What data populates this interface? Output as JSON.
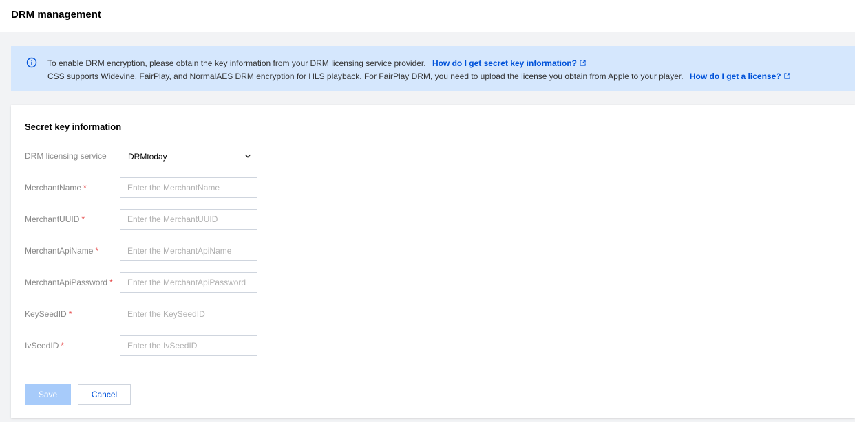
{
  "header": {
    "title": "DRM management"
  },
  "notice": {
    "line1_text": "To enable DRM encryption, please obtain the key information from your DRM licensing service provider.",
    "line1_link": "How do I get secret key information?",
    "line2_text": "CSS supports Widevine, FairPlay, and NormalAES DRM encryption for HLS playback. For FairPlay DRM, you need to upload the license you obtain from Apple to your player.",
    "line2_link": "How do I get a license?",
    "accent_color": "#0052d9",
    "background_color": "#d5e7fd"
  },
  "form": {
    "section_title": "Secret key information",
    "service": {
      "label": "DRM licensing service",
      "value": "DRMtoday"
    },
    "fields": [
      {
        "label": "MerchantName",
        "required_mark": "*",
        "placeholder": "Enter the MerchantName",
        "value": ""
      },
      {
        "label": "MerchantUUID",
        "required_mark": "*",
        "placeholder": "Enter the MerchantUUID",
        "value": ""
      },
      {
        "label": "MerchantApiName",
        "required_mark": "*",
        "placeholder": "Enter the MerchantApiName",
        "value": ""
      },
      {
        "label": "MerchantApiPassword",
        "required_mark": "*",
        "placeholder": "Enter the MerchantApiPassword",
        "value": ""
      },
      {
        "label": "KeySeedID",
        "required_mark": "*",
        "placeholder": "Enter the KeySeedID",
        "value": ""
      },
      {
        "label": "IvSeedID",
        "required_mark": "*",
        "placeholder": "Enter the IvSeedID",
        "value": ""
      }
    ]
  },
  "actions": {
    "save_label": "Save",
    "cancel_label": "Cancel",
    "save_disabled_color": "#a7cbfa"
  },
  "icons": {
    "info": "info-circle-icon",
    "external_link": "external-link-icon",
    "dropdown": "chevron-down-icon"
  }
}
